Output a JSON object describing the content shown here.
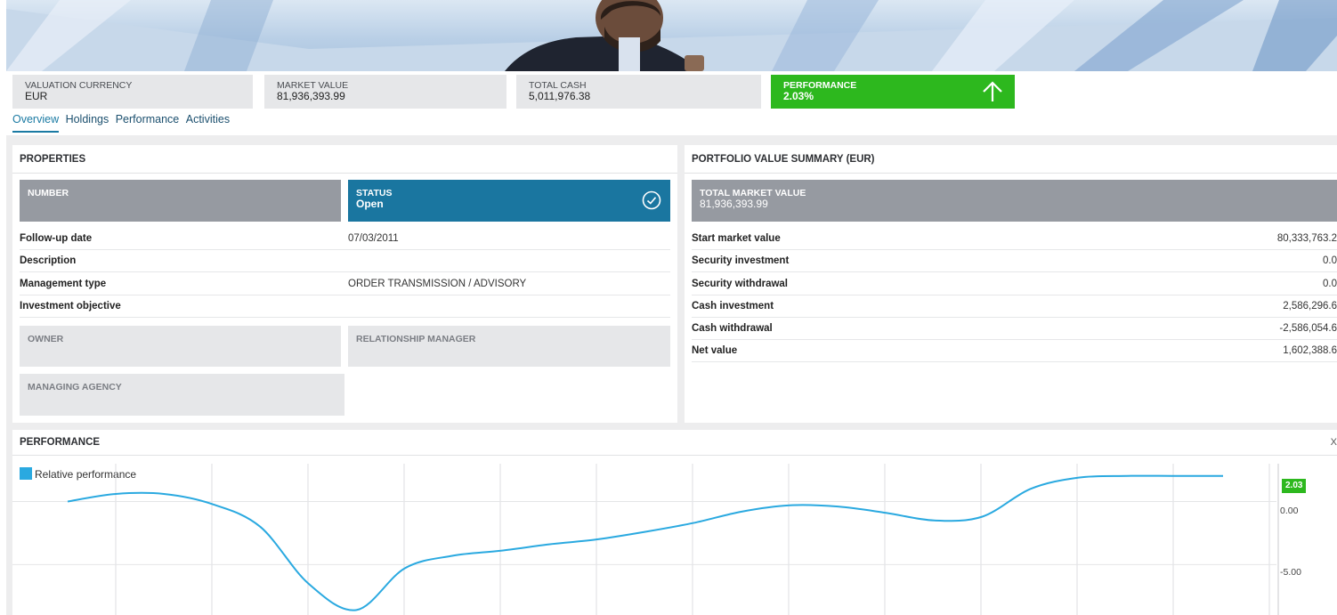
{
  "kpis": [
    {
      "label": "VALUATION CURRENCY",
      "value": "EUR"
    },
    {
      "label": "MARKET VALUE",
      "value": "81,936,393.99"
    },
    {
      "label": "TOTAL CASH",
      "value": "5,011,976.38"
    },
    {
      "label": "PERFORMANCE",
      "value": "2.03%"
    }
  ],
  "tabs": [
    "Overview",
    "Holdings",
    "Performance",
    "Activities"
  ],
  "properties": {
    "title": "PROPERTIES",
    "number_label": "NUMBER",
    "status_label": "STATUS",
    "status_value": "Open",
    "rows": [
      {
        "label": "Follow-up date",
        "value": "07/03/2011"
      },
      {
        "label": "Description",
        "value": ""
      },
      {
        "label": "Management type",
        "value": "ORDER TRANSMISSION / ADVISORY"
      },
      {
        "label": "Investment objective",
        "value": ""
      }
    ],
    "owner_label": "OWNER",
    "relationship_label": "RELATIONSHIP MANAGER",
    "agency_label": "MANAGING AGENCY"
  },
  "summary": {
    "title": "PORTFOLIO VALUE SUMMARY (EUR)",
    "total_label": "TOTAL MARKET VALUE",
    "total_value": "81,936,393.99",
    "rows": [
      {
        "label": "Start market value",
        "value": "80,333,763.2"
      },
      {
        "label": "Security investment",
        "value": "0.0"
      },
      {
        "label": "Security withdrawal",
        "value": "0.0"
      },
      {
        "label": "Cash investment",
        "value": "2,586,296.6"
      },
      {
        "label": "Cash withdrawal",
        "value": "-2,586,054.6"
      },
      {
        "label": "Net value",
        "value": "1,602,388.6"
      }
    ]
  },
  "performance": {
    "title": "PERFORMANCE",
    "close_glyph": "X",
    "badge": "2.03",
    "y_ticks": [
      "0.00",
      "-5.00"
    ]
  },
  "colors": {
    "accent": "#1a76a0",
    "positive": "#2db81e",
    "line": "#2aa9e0"
  },
  "chart_data": {
    "type": "line",
    "title": "PERFORMANCE",
    "series": [
      {
        "name": "Relative performance",
        "x": [
          1,
          2,
          3,
          4,
          5,
          6,
          7,
          8,
          9,
          10,
          11,
          12,
          13,
          14,
          15,
          16,
          17,
          18,
          19,
          20,
          21,
          22,
          23,
          24,
          25
        ],
        "values": [
          0.0,
          0.6,
          0.6,
          -0.2,
          -2.0,
          -6.5,
          -8.6,
          -5.3,
          -4.3,
          -3.9,
          -3.4,
          -3.0,
          -2.4,
          -1.7,
          -0.8,
          -0.3,
          -0.4,
          -0.9,
          -1.5,
          -1.2,
          1.0,
          1.9,
          2.03,
          2.03,
          2.03
        ]
      }
    ],
    "y_ticks": [
      0,
      -5
    ],
    "ylim": [
      -9,
      3
    ],
    "legend": "top-left",
    "grid": true
  }
}
